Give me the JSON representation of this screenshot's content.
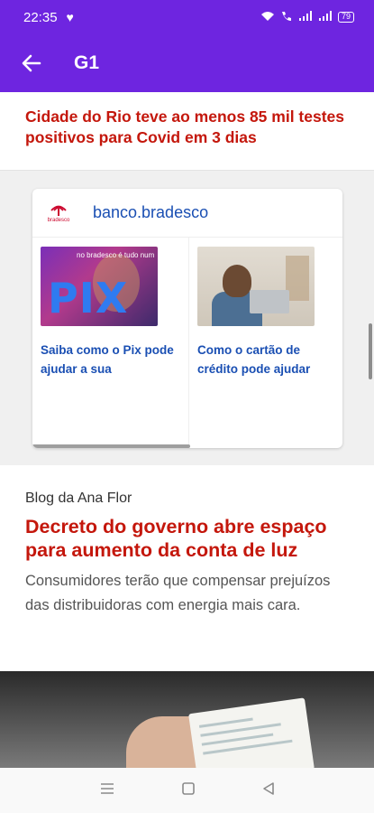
{
  "status_bar": {
    "time": "22:35",
    "battery": "79"
  },
  "app_bar": {
    "title": "G1"
  },
  "headline1": {
    "text": "Cidade do Rio teve ao menos 85 mil testes positivos para Covid em 3 dias"
  },
  "ad": {
    "logo_word": "bradesco",
    "brand": "banco.bradesco",
    "items": [
      {
        "caption": "Saiba como o Pix pode ajudar a sua",
        "thumb_tag": "no bradesco é tudo num",
        "thumb_big": "PIX"
      },
      {
        "caption": "Como o cartão de crédito pode ajudar"
      }
    ]
  },
  "article": {
    "blog": "Blog da Ana Flor",
    "title": "Decreto do governo abre espaço para aumento da conta de luz",
    "summary": "Consumidores terão que compensar prejuízos das distribuidoras com energia mais cara."
  },
  "colors": {
    "brand_purple": "#6e25e0",
    "headline_red": "#c4170c",
    "link_blue": "#1a4fb3"
  }
}
